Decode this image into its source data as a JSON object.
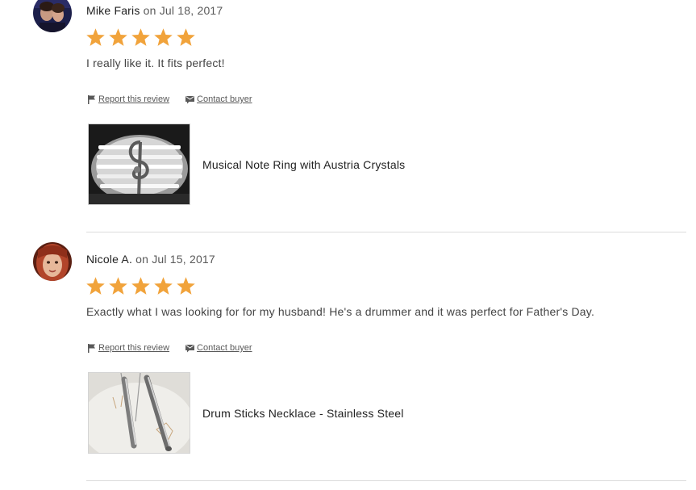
{
  "reviews": [
    {
      "reviewer": "Mike Faris",
      "date_text": "on Jul 18, 2017",
      "rating": 5,
      "rating_max": 5,
      "text": "I really like it. It fits perfect!",
      "report_label": "Report this review",
      "contact_label": "Contact buyer",
      "product_title": "Musical Note Ring with Austria Crystals"
    },
    {
      "reviewer": "Nicole A.",
      "date_text": "on Jul 15, 2017",
      "rating": 5,
      "rating_max": 5,
      "text": "Exactly what I was looking for for my husband! He's a drummer and it was perfect for Father's Day.",
      "report_label": "Report this review",
      "contact_label": "Contact buyer",
      "product_title": "Drum Sticks Necklace - Stainless Steel"
    }
  ],
  "colors": {
    "star": "#f1a33b",
    "text": "#222222",
    "muted": "#595959",
    "divider": "#dcdcdc"
  },
  "icons": {
    "report": "flag-icon",
    "contact": "envelope-icon",
    "rating": "star-icon"
  }
}
